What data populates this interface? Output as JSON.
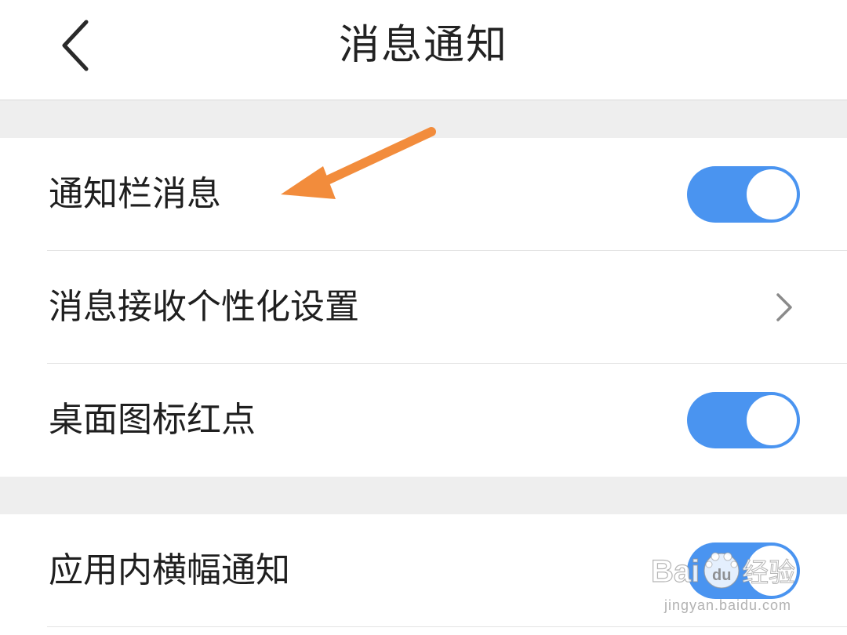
{
  "header": {
    "title": "消息通知",
    "back_icon": "chevron-left-icon"
  },
  "sections": [
    {
      "rows": [
        {
          "label": "通知栏消息",
          "control": "toggle",
          "on": true
        },
        {
          "label": "消息接收个性化设置",
          "control": "chevron",
          "icon": "chevron-right-icon"
        },
        {
          "label": "桌面图标红点",
          "control": "toggle",
          "on": true
        }
      ]
    },
    {
      "rows": [
        {
          "label": "应用内横幅通知",
          "control": "toggle",
          "on": true
        }
      ]
    }
  ],
  "annotation": {
    "arrow_color": "#f28c3c",
    "icon": "arrow-annotation-icon"
  },
  "watermark": {
    "logo_text_left": "Bai",
    "logo_text_mid": "du",
    "logo_text_right": "经验",
    "url": "jingyan.baidu.com"
  },
  "colors": {
    "toggle_on": "#4a94f0",
    "background_gap": "#eeeeee",
    "text": "#1f1f1f"
  }
}
